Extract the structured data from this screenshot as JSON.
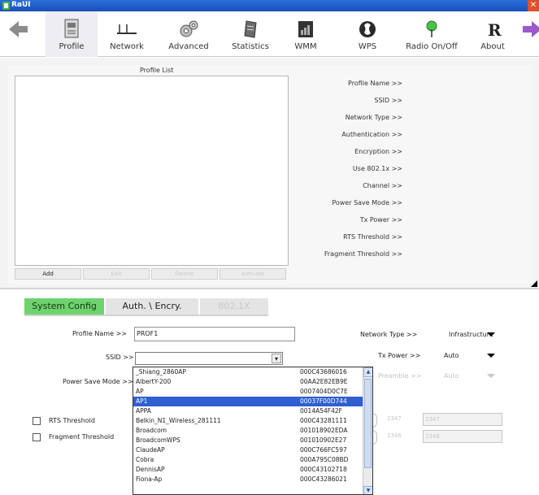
{
  "window": {
    "title": "RaUI",
    "close_glyph": "✕"
  },
  "toolbar": {
    "items": [
      {
        "label": "",
        "icon": "back-arrow-icon"
      },
      {
        "label": "Profile",
        "icon": "profile-icon"
      },
      {
        "label": "Network",
        "icon": "network-icon"
      },
      {
        "label": "Advanced",
        "icon": "gears-icon"
      },
      {
        "label": "Statistics",
        "icon": "statistics-icon"
      },
      {
        "label": "WMM",
        "icon": "wmm-icon"
      },
      {
        "label": "WPS",
        "icon": "wps-icon"
      },
      {
        "label": "Radio On/Off",
        "icon": "radio-icon"
      },
      {
        "label": "About",
        "icon": "about-icon"
      },
      {
        "label": "",
        "icon": "forward-arrow-icon"
      }
    ]
  },
  "profile_list": {
    "title": "Profile List",
    "buttons": {
      "add": "Add",
      "edit": "Edit",
      "delete": "Delete",
      "activate": "Activate"
    }
  },
  "details": {
    "profile_name": "Profile Name >>",
    "ssid": "SSID >>",
    "network_type": "Network Type >>",
    "authentication": "Authentication >>",
    "encryption": "Encryption >>",
    "use_8021x": "Use 802.1x >>",
    "channel": "Channel >>",
    "power_save_mode": "Power Save Mode >>",
    "tx_power": "Tx Power >>",
    "rts_threshold": "RTS Threshold >>",
    "fragment_threshold": "Fragment Threshold >>"
  },
  "tabs": {
    "system_config": "System Config",
    "auth_encry": "Auth. \\ Encry.",
    "x8021": "802.1X"
  },
  "form": {
    "profile_name_label": "Profile Name >>",
    "profile_name_value": "PROF1",
    "ssid_label": "SSID >>",
    "ssid_value": "",
    "power_save_label": "Power Save Mode >>",
    "network_type_label": "Network Type >>",
    "network_type_value": "Infrastructure",
    "tx_power_label": "Tx Power >>",
    "tx_power_value": "Auto",
    "preamble_label": "Preamble >>",
    "preamble_value": "Auto",
    "rts_label": "RTS Threshold",
    "fragment_label": "Fragment Threshold",
    "rts_min": "2347",
    "rts_value": "2347",
    "frag_min": "2346",
    "frag_value": "2346"
  },
  "ssid_dropdown": {
    "rows": [
      {
        "ssid": "_Shiang_2860AP",
        "mac": "000C43686016"
      },
      {
        "ssid": "AlbertY-200",
        "mac": "00AA2E82EB9E"
      },
      {
        "ssid": "AP",
        "mac": "0007404D0C7E"
      },
      {
        "ssid": "AP1",
        "mac": "00037F00D744",
        "selected": true
      },
      {
        "ssid": "APPA",
        "mac": "0014A54F42F"
      },
      {
        "ssid": "Belkin_N1_Wireless_281111",
        "mac": "000C43281111"
      },
      {
        "ssid": "Broadcom",
        "mac": "001018902EDA"
      },
      {
        "ssid": "BroadcomWPS",
        "mac": "001010902E27"
      },
      {
        "ssid": "ClaudeAP",
        "mac": "000C766FC597"
      },
      {
        "ssid": "Cobra",
        "mac": "000A795C08BD"
      },
      {
        "ssid": "DennisAP",
        "mac": "000C43102718"
      },
      {
        "ssid": "Fiona-Ap",
        "mac": "000C43286021"
      }
    ]
  }
}
